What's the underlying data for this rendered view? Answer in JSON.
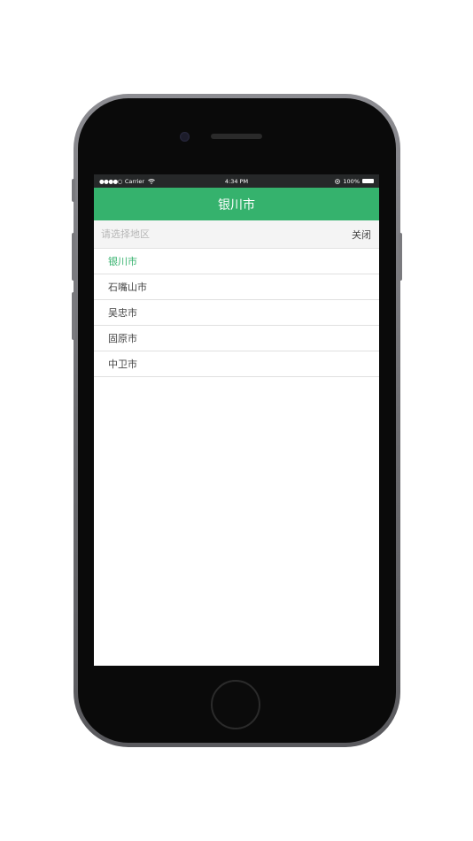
{
  "status_bar": {
    "signal": "●●●●○",
    "carrier": "Carrier",
    "wifi_icon": "wifi-icon",
    "time": "4:34 PM",
    "lock_icon": "orientation-lock-icon",
    "battery_percent": "100%"
  },
  "nav": {
    "title": "银川市"
  },
  "search": {
    "placeholder": "请选择地区",
    "value": "",
    "close_label": "关闭"
  },
  "list": {
    "selected_index": 0,
    "items": [
      {
        "label": "银川市"
      },
      {
        "label": "石嘴山市"
      },
      {
        "label": "吴忠市"
      },
      {
        "label": "固原市"
      },
      {
        "label": "中卫市"
      }
    ]
  },
  "colors": {
    "accent": "#35b26d",
    "status_bar_bg": "#262829",
    "search_bg": "#f4f4f4"
  }
}
